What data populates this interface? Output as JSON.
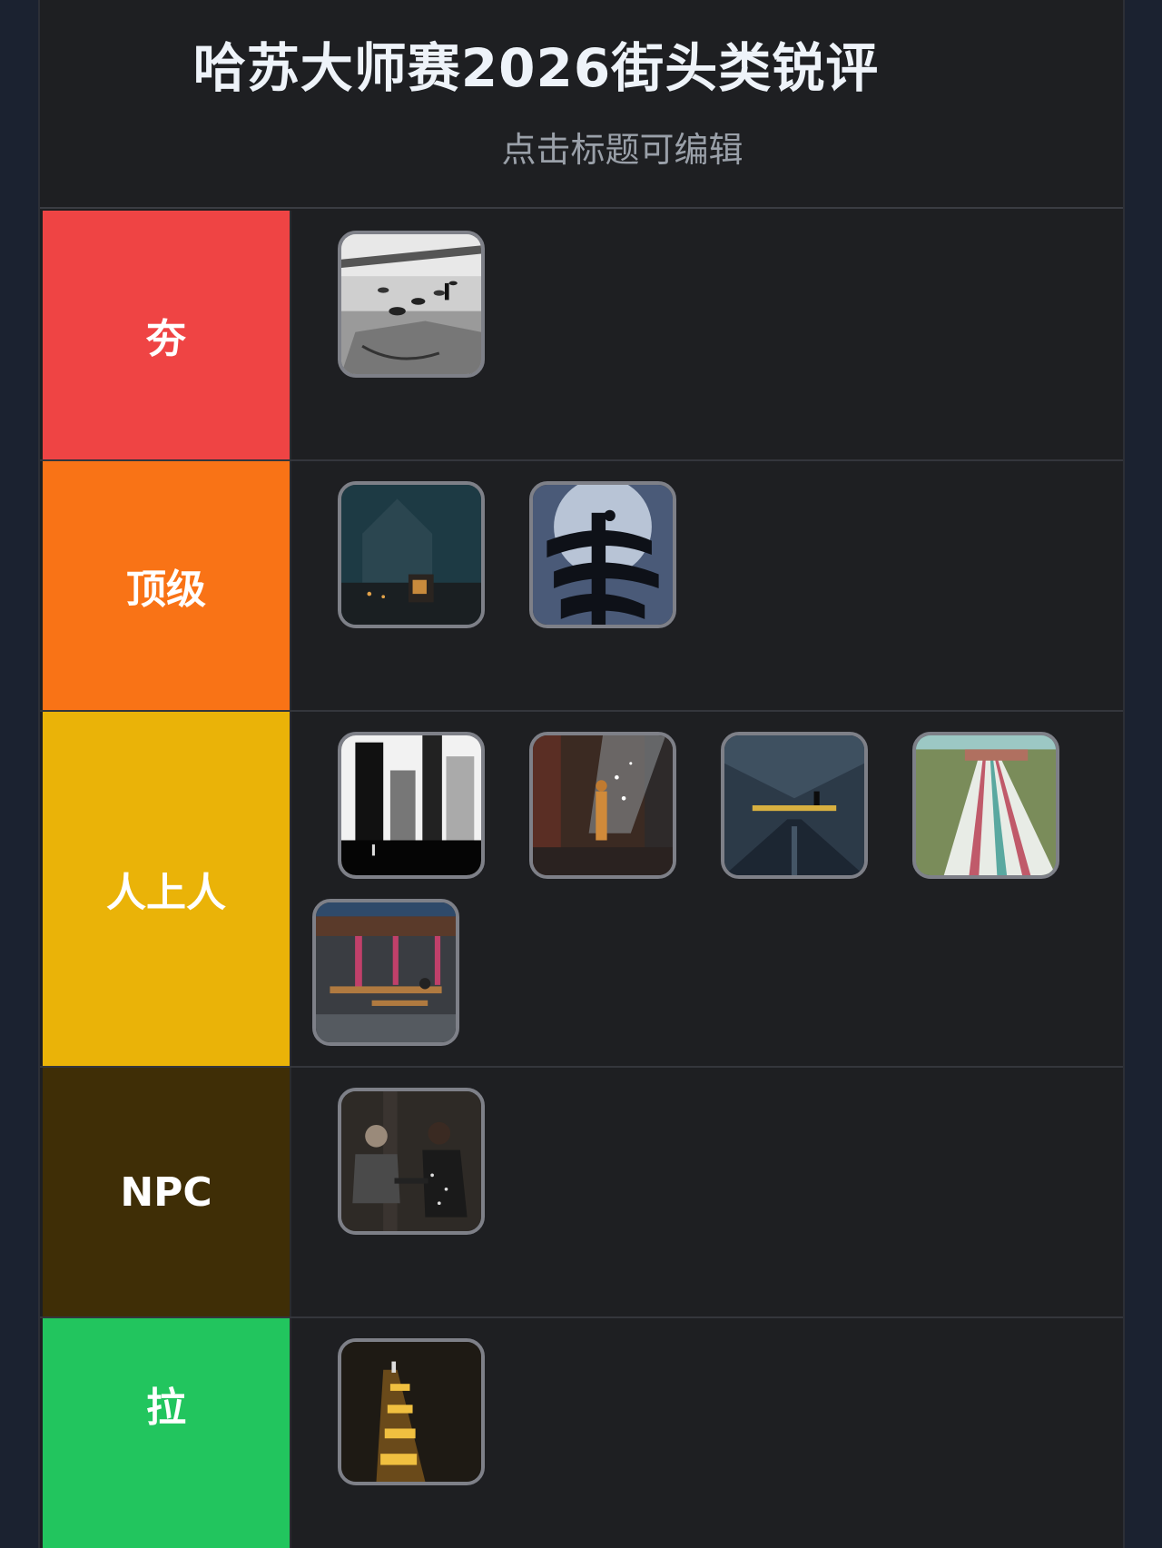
{
  "header": {
    "title": "哈苏大师赛2026街头类锐评",
    "subtitle": "点击标题可编辑"
  },
  "tiers": [
    {
      "label": "夯",
      "color": "#ef4444",
      "items": [
        "pigeons-bw-photo"
      ]
    },
    {
      "label": "顶级",
      "color": "#f97316",
      "items": [
        "foggy-cathedral-photo",
        "spiral-stairs-photo"
      ]
    },
    {
      "label": "人上人",
      "color": "#eab308",
      "items": [
        "skyscrapers-bw-photo",
        "sparks-worker-photo",
        "underpass-figure-photo",
        "water-slides-photo",
        "canteen-tables-photo"
      ]
    },
    {
      "label": "NPC",
      "color": "#3f2e06",
      "items": [
        "cafe-couple-photo"
      ]
    },
    {
      "label": "拉",
      "color": "#22c55e",
      "items": [
        "light-stripes-floor-photo"
      ]
    }
  ]
}
